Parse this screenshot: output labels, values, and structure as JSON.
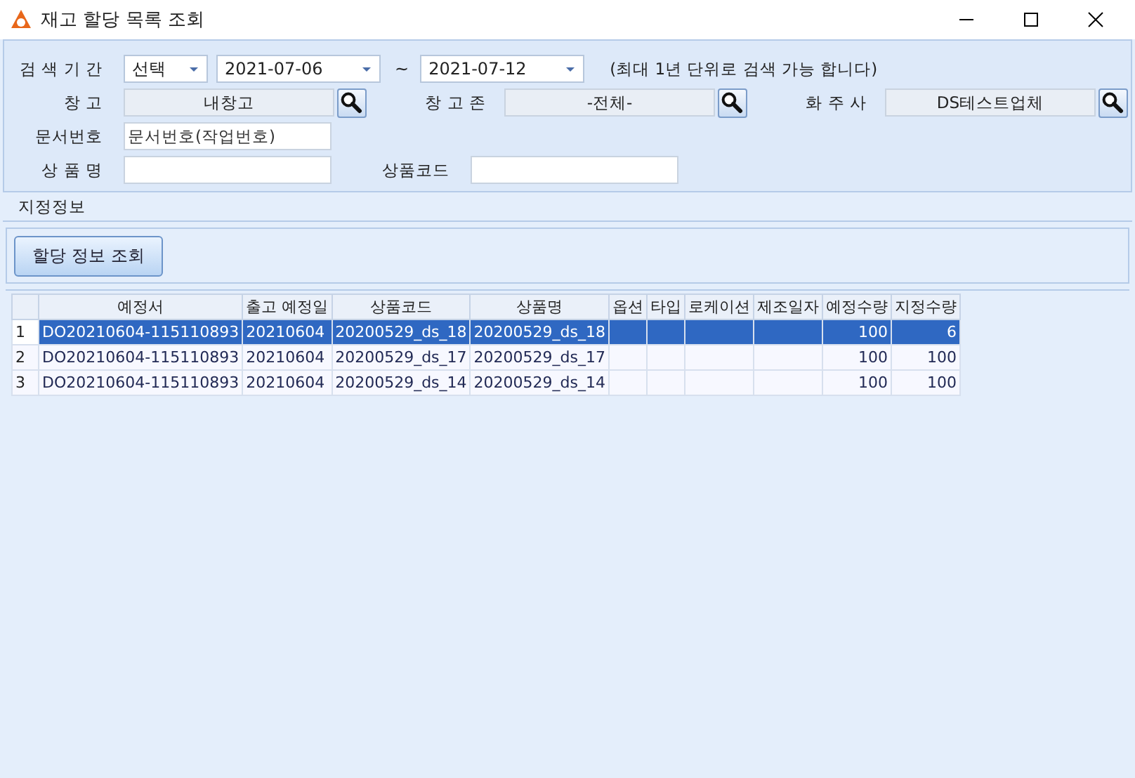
{
  "window": {
    "title": "재고 할당 목록 조회"
  },
  "search": {
    "period_label": "검 색 기 간",
    "period_type": "선택",
    "date_from": "2021-07-06",
    "separator": "~",
    "date_to": "2021-07-12",
    "note": "(최대 1년 단위로 검색 가능 합니다)",
    "lookups": [
      {
        "label": "창 고",
        "value": "내창고"
      },
      {
        "label": "창 고 존",
        "value": "-전체-"
      },
      {
        "label": "화 주 사",
        "value": "DS테스트업체"
      }
    ],
    "doc_label": "문서번호",
    "doc_placeholder": "문서번호(작업번호)",
    "product_name_label": "상 품 명",
    "product_code_label": "상품코드"
  },
  "section": {
    "title": "지정정보"
  },
  "buttons": [
    "할당 정보 조회"
  ],
  "table": {
    "columns": [
      "예정서",
      "출고 예정일",
      "상품코드",
      "상품명",
      "옵션",
      "타입",
      "로케이션",
      "제조일자",
      "예정수량",
      "지정수량"
    ],
    "rows": [
      {
        "number": "1",
        "selected": true,
        "cells": [
          "DO20210604-115110893",
          "20210604",
          "20200529_ds_18",
          "20200529_ds_18",
          "",
          "",
          "",
          "",
          "100",
          "6"
        ]
      },
      {
        "number": "2",
        "selected": false,
        "cells": [
          "DO20210604-115110893",
          "20210604",
          "20200529_ds_17",
          "20200529_ds_17",
          "",
          "",
          "",
          "",
          "100",
          "100"
        ]
      },
      {
        "number": "3",
        "selected": false,
        "cells": [
          "DO20210604-115110893",
          "20210604",
          "20200529_ds_14",
          "20200529_ds_14",
          "",
          "",
          "",
          "",
          "100",
          "100"
        ]
      }
    ]
  }
}
